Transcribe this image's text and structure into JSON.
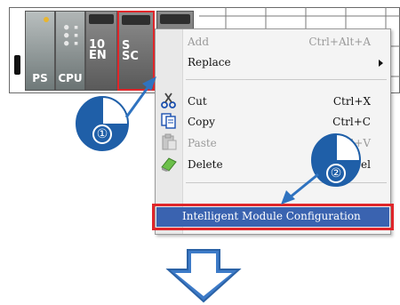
{
  "rack": {
    "modules": [
      {
        "label": "PS"
      },
      {
        "label": "CPU"
      },
      {
        "label": "10\nEN"
      },
      {
        "label": "S\nSC"
      },
      {
        "label": ""
      }
    ]
  },
  "context_menu": {
    "items": [
      {
        "label": "Add",
        "shortcut": "Ctrl+Alt+A",
        "enabled": false,
        "icon": ""
      },
      {
        "label": "Replace",
        "shortcut": "",
        "enabled": true,
        "icon": "",
        "submenu": true
      },
      {
        "label": "Cut",
        "shortcut": "Ctrl+X",
        "enabled": true,
        "icon": "scissors-icon"
      },
      {
        "label": "Copy",
        "shortcut": "Ctrl+C",
        "enabled": true,
        "icon": "copy-icon"
      },
      {
        "label": "Paste",
        "shortcut": "Ctrl+V",
        "enabled": false,
        "icon": "paste-icon"
      },
      {
        "label": "Delete",
        "shortcut": "Del",
        "enabled": true,
        "icon": "eraser-icon"
      },
      {
        "label": "Intelligent Module Configuration",
        "shortcut": "",
        "enabled": true,
        "icon": "",
        "highlighted": true
      }
    ]
  },
  "step_markers": [
    {
      "number": "①"
    },
    {
      "number": "②"
    }
  ],
  "colors": {
    "highlight_border": "#e0262a",
    "highlight_fill": "#3a63b0",
    "marker_blue": "#1f5fa8",
    "arrow_blue": "#2f73c0"
  }
}
